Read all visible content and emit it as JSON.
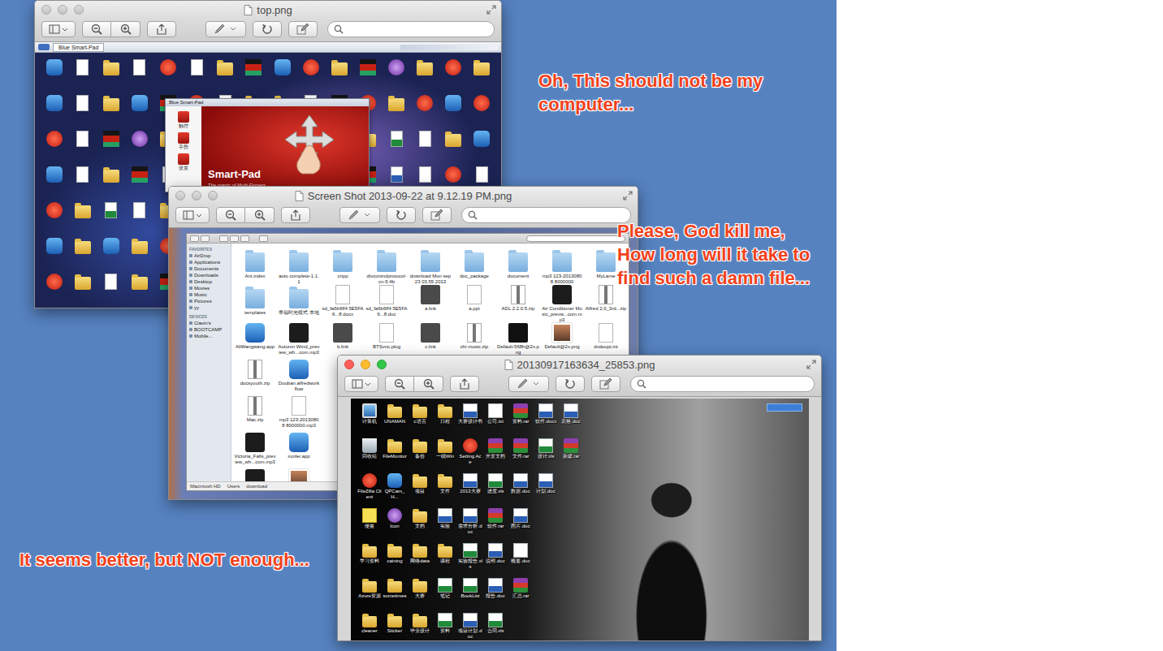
{
  "desktop_notes": [
    {
      "lines": [
        "Oh, This should not be my",
        "computer..."
      ]
    },
    {
      "lines": [
        "Please, God kill me,",
        "How long will it take to",
        "find such a damn file..."
      ]
    },
    {
      "lines": [
        "It seems better, but NOT enough..."
      ]
    }
  ],
  "top_window": {
    "title": "top.png",
    "active": false,
    "taskbar": {
      "items": [
        "Blue Smart-Pad"
      ]
    },
    "icons": [
      {
        "kind": "app"
      },
      {
        "kind": "doc"
      },
      {
        "kind": "folder"
      },
      {
        "kind": "doc"
      },
      {
        "kind": "red"
      },
      {
        "kind": "doc"
      },
      {
        "kind": "folder"
      },
      {
        "kind": "flag"
      },
      {
        "kind": "app"
      },
      {
        "kind": "red"
      },
      {
        "kind": "folder"
      },
      {
        "kind": "flag"
      },
      {
        "kind": "purple"
      },
      {
        "kind": "folder"
      },
      {
        "kind": "red"
      },
      {
        "kind": "folder"
      },
      {
        "kind": "app"
      },
      {
        "kind": "doc"
      },
      {
        "kind": "folder"
      },
      {
        "kind": "app"
      },
      {
        "kind": "flag"
      },
      {
        "kind": "red"
      },
      {
        "kind": "doc"
      },
      {
        "kind": "folder"
      },
      {
        "kind": "folder"
      },
      {
        "kind": "doc"
      },
      {
        "kind": "flag"
      },
      {
        "kind": "red"
      },
      {
        "kind": "folder"
      },
      {
        "kind": "red"
      },
      {
        "kind": "app"
      },
      {
        "kind": "red"
      },
      {
        "kind": "red"
      },
      {
        "kind": "doc"
      },
      {
        "kind": "flag"
      },
      {
        "kind": "purple"
      },
      {
        "kind": "folder"
      },
      {
        "kind": "doc"
      },
      {
        "kind": "red"
      },
      {
        "kind": "folder"
      },
      {
        "kind": "flag"
      },
      {
        "kind": "app"
      },
      {
        "kind": "doc"
      },
      {
        "kind": "folder"
      },
      {
        "kind": "excel"
      },
      {
        "kind": "doc"
      },
      {
        "kind": "folder"
      },
      {
        "kind": "app"
      },
      {
        "kind": "app"
      },
      {
        "kind": "doc"
      },
      {
        "kind": "folder"
      },
      {
        "kind": "flag"
      },
      {
        "kind": "doc"
      },
      {
        "kind": "folder"
      },
      {
        "kind": "doc"
      },
      {
        "kind": "red"
      },
      {
        "kind": "folder"
      },
      {
        "kind": "app"
      },
      {
        "kind": "doc"
      },
      {
        "kind": "flag"
      },
      {
        "kind": "word"
      },
      {
        "kind": "doc"
      },
      {
        "kind": "red"
      },
      {
        "kind": "doc"
      },
      {
        "kind": "red"
      },
      {
        "kind": "folder"
      },
      {
        "kind": "excel"
      },
      {
        "kind": "doc"
      },
      {
        "kind": "folder"
      },
      {
        "kind": "flag"
      },
      {
        "kind": "red"
      },
      {
        "kind": "doc"
      },
      {
        "kind": "folder"
      },
      {
        "kind": "doc"
      },
      {
        "kind": "app"
      },
      {
        "kind": "red"
      },
      {
        "kind": "folder"
      },
      {
        "kind": "doc"
      },
      {
        "kind": "flag"
      },
      {
        "kind": "red"
      },
      {
        "kind": "app"
      },
      {
        "kind": "folder"
      },
      {
        "kind": "app"
      },
      {
        "kind": "folder"
      },
      {
        "kind": "red"
      },
      {
        "kind": "doc"
      },
      {
        "kind": "folder"
      },
      {
        "kind": "flag"
      },
      {
        "kind": "doc"
      },
      {
        "kind": "red"
      },
      {
        "kind": "folder"
      },
      {
        "kind": "doc"
      },
      {
        "kind": "flag"
      },
      {
        "kind": "folder"
      },
      {
        "kind": "doc"
      },
      {
        "kind": "red"
      },
      {
        "kind": "red"
      },
      {
        "kind": "folder"
      },
      {
        "kind": "doc"
      },
      {
        "kind": "folder"
      },
      {
        "kind": "flag"
      },
      {
        "kind": "doc"
      },
      {
        "kind": "red"
      },
      {
        "kind": "folder"
      },
      {
        "kind": "doc"
      },
      {
        "kind": "app"
      },
      {
        "kind": "folder"
      },
      {
        "kind": "red"
      },
      {
        "kind": "doc"
      },
      {
        "kind": "flag"
      },
      {
        "kind": "folder"
      },
      {
        "kind": "doc"
      }
    ],
    "smartpad": {
      "title": "Blue Smart-Pad",
      "name": "Smart-Pad",
      "tagline": "The magic of Multi-Fingers",
      "menu": [
        "触控",
        "手势",
        "设置"
      ]
    }
  },
  "finder_window": {
    "title": "Screen Shot 2013-09-22 at 9.12.19 PM.png",
    "active": false,
    "sidebar": [
      {
        "heading": "FAVORITES",
        "items": [
          "AirDrop",
          "Applications",
          "Documents",
          "Downloads",
          "Desktop",
          "Movies",
          "Music",
          "Pictures",
          "yy"
        ]
      },
      {
        "heading": "DEVICES",
        "items": [
          "Clavin's",
          "BOOTCAMP",
          "Mobile..."
        ]
      }
    ],
    "file_rows": [
      [
        {
          "name": "Ant.index",
          "kind": "mfolder"
        },
        {
          "name": "auto complete-1.1.1",
          "kind": "mfolder"
        },
        {
          "name": "cnpp",
          "kind": "mfolder"
        },
        {
          "name": "divcontrolprotocol-cn-5.4b",
          "kind": "mfolder"
        },
        {
          "name": "download Mon sep 23 03.55 2013",
          "kind": "mfolder"
        },
        {
          "name": "doc_package",
          "kind": "mfolder"
        },
        {
          "name": "document",
          "kind": "mfolder"
        },
        {
          "name": "mp3 123-20130808 8000000",
          "kind": "mfolder"
        },
        {
          "name": "MyLame",
          "kind": "mfolder"
        }
      ],
      [
        {
          "name": "templates",
          "kind": "mfolder"
        },
        {
          "name": "幸福时光模式 本地",
          "kind": "mfolder"
        },
        {
          "name": "sd_fa6b6ff4 5E5FA6...8.docx",
          "kind": "doc"
        },
        {
          "name": "sd_fa6b6ff4 5E5FA6...8.doc",
          "kind": "doc"
        },
        {
          "name": "a.link",
          "kind": "link"
        },
        {
          "name": "a.ppt",
          "kind": "doc"
        },
        {
          "name": "ADL 2.2.0.5.zip",
          "kind": "zip"
        },
        {
          "name": "Air Conditioner Music_prevw...com.mp3",
          "kind": "music"
        },
        {
          "name": "Alfred 2.0_3rd...zip",
          "kind": "zip"
        }
      ],
      [
        {
          "name": "AliWangwang.app",
          "kind": "app"
        },
        {
          "name": "Autumn Wind_preview_wh...com.mp3",
          "kind": "music"
        },
        {
          "name": "b.link",
          "kind": "link"
        },
        {
          "name": "BTSvnc.plug",
          "kind": "doc"
        },
        {
          "name": "c.link",
          "kind": "link"
        },
        {
          "name": "chi music.zip",
          "kind": "zip"
        },
        {
          "name": "Default-568h@2x.png",
          "kind": "phone"
        },
        {
          "name": "Default@2x.png",
          "kind": "image"
        },
        {
          "name": "dvdoupt.int",
          "kind": "doc"
        }
      ],
      [
        {
          "name": "docsyouth.zip",
          "kind": "zip"
        },
        {
          "name": "Douban.alfredworkflow",
          "kind": "app"
        }
      ],
      [
        {
          "name": "Mac.zip",
          "kind": "zip"
        },
        {
          "name": "mp3 123-20130808 8000000.mp3",
          "kind": "doc"
        }
      ],
      [
        {
          "name": "Victoria_Falls_preview_wh...com.mp3",
          "kind": "music"
        },
        {
          "name": "xunlei.app",
          "kind": "app"
        }
      ],
      [
        {
          "kind": "music"
        },
        {
          "kind": "image"
        }
      ]
    ],
    "path": [
      "Macintosh HD",
      "Users",
      "download"
    ]
  },
  "photo_window": {
    "title": "20130917163634_25853.png",
    "active": true,
    "columns": [
      [
        {
          "name": "计算机",
          "kind": "pc"
        },
        {
          "name": "回收站",
          "kind": "trash"
        },
        {
          "name": "FileZilla Client",
          "kind": "red"
        },
        {
          "name": "便签",
          "kind": "note"
        },
        {
          "name": "学习资料",
          "kind": "folder"
        },
        {
          "name": "Azure资源",
          "kind": "folder"
        },
        {
          "name": "cleaner",
          "kind": "folder"
        }
      ],
      [
        {
          "name": "UNAMAN",
          "kind": "folder"
        },
        {
          "name": "FileMonitor",
          "kind": "folder"
        },
        {
          "name": "QPCam_H...",
          "kind": "app"
        },
        {
          "name": "Icon",
          "kind": "purple"
        },
        {
          "name": "caining",
          "kind": "folder"
        },
        {
          "name": "sometimes",
          "kind": "folder"
        },
        {
          "name": "Sticker",
          "kind": "folder"
        }
      ],
      [
        {
          "name": "c语言",
          "kind": "folder"
        },
        {
          "name": "备份",
          "kind": "folder"
        },
        {
          "name": "项目",
          "kind": "folder"
        },
        {
          "name": "文档",
          "kind": "folder"
        },
        {
          "name": "网络data",
          "kind": "folder"
        },
        {
          "name": "大赛",
          "kind": "folder"
        },
        {
          "name": "毕业设计",
          "kind": "folder"
        }
      ],
      [
        {
          "name": "日程",
          "kind": "folder"
        },
        {
          "name": "一级Win",
          "kind": "folder"
        },
        {
          "name": "文件",
          "kind": "folder"
        },
        {
          "name": "实验",
          "kind": "word"
        },
        {
          "name": "课程",
          "kind": "folder"
        },
        {
          "name": "笔记",
          "kind": "excel"
        },
        {
          "name": "资料",
          "kind": "excel"
        }
      ],
      [
        {
          "name": "大赛设计书",
          "kind": "word"
        },
        {
          "name": "Setting Ace",
          "kind": "red"
        },
        {
          "name": "2013大赛",
          "kind": "word"
        },
        {
          "name": "需求分析.doc",
          "kind": "word"
        },
        {
          "name": "实验报告.xls",
          "kind": "excel"
        },
        {
          "name": "BookList",
          "kind": "excel"
        },
        {
          "name": "项目计划.doc",
          "kind": "word"
        }
      ],
      [
        {
          "name": "公司.txt",
          "kind": "doc"
        },
        {
          "name": "开发文档",
          "kind": "rar"
        },
        {
          "name": "进度.xls",
          "kind": "excel"
        },
        {
          "name": "软件.rar",
          "kind": "rar"
        },
        {
          "name": "说明.doc",
          "kind": "word"
        },
        {
          "name": "报告.doc",
          "kind": "word"
        },
        {
          "name": "合同.xls",
          "kind": "excel"
        }
      ],
      [
        {
          "name": "资料.rar",
          "kind": "rar"
        },
        {
          "name": "文件.rar",
          "kind": "rar"
        },
        {
          "name": "数据.doc",
          "kind": "word"
        },
        {
          "name": "图片.doc",
          "kind": "word"
        },
        {
          "name": "概要.doc",
          "kind": "doc"
        },
        {
          "name": "汇总.rar",
          "kind": "rar"
        }
      ],
      [
        {
          "name": "软件.docx",
          "kind": "word"
        },
        {
          "name": "设计.xls",
          "kind": "excel"
        },
        {
          "name": "计划.doc",
          "kind": "word"
        }
      ],
      [
        {
          "name": "表格.doc",
          "kind": "word"
        },
        {
          "name": "新建.rar",
          "kind": "rar"
        }
      ]
    ]
  }
}
